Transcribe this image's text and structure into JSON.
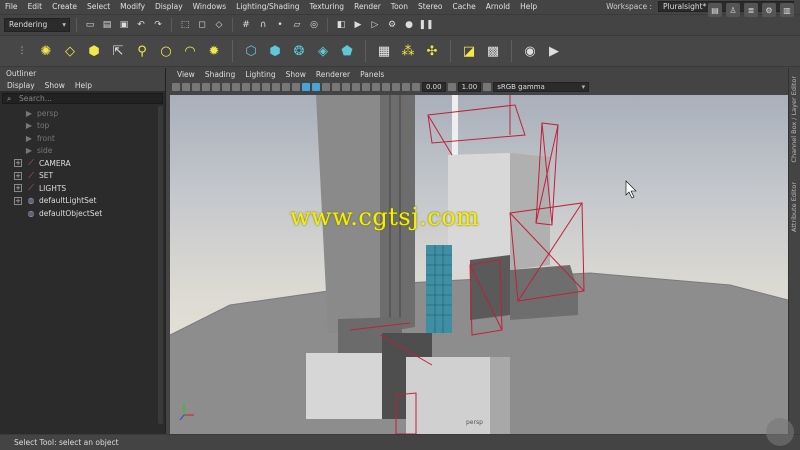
{
  "menubar": {
    "items": [
      "File",
      "Edit",
      "Create",
      "Select",
      "Modify",
      "Display",
      "Windows",
      "Lighting/Shading",
      "Texturing",
      "Render",
      "Toon",
      "Stereo",
      "Cache",
      "Arnold",
      "Help"
    ],
    "workspace_label": "Workspace :",
    "workspace_value": "Pluralsight*"
  },
  "statusline": {
    "menu_set": "Rendering"
  },
  "outliner": {
    "title": "Outliner",
    "menu": [
      "Display",
      "Show",
      "Help"
    ],
    "search_placeholder": "Search...",
    "cameras": [
      "persp",
      "top",
      "front",
      "side"
    ],
    "groups": [
      "CAMERA",
      "SET",
      "LIGHTS"
    ],
    "sets": [
      "defaultLightSet",
      "defaultObjectSet"
    ]
  },
  "viewport": {
    "menu": [
      "View",
      "Shading",
      "Lighting",
      "Show",
      "Renderer",
      "Panels"
    ],
    "exposure": "0.00",
    "gamma": "1.00",
    "color_space": "sRGB gamma",
    "camera_label": "persp",
    "watermark": "www.cgtsj.com"
  },
  "sidetabs": {
    "channel_box": "Channel Box / Layer Editor",
    "attribute_editor": "Attribute Editor"
  },
  "helpline": {
    "text": "Select Tool: select an object"
  },
  "colors": {
    "accent": "#4aa3d8",
    "wire": "#c0203a",
    "watermark": "#f5ef00",
    "building_glass": "#3e8fa3"
  }
}
